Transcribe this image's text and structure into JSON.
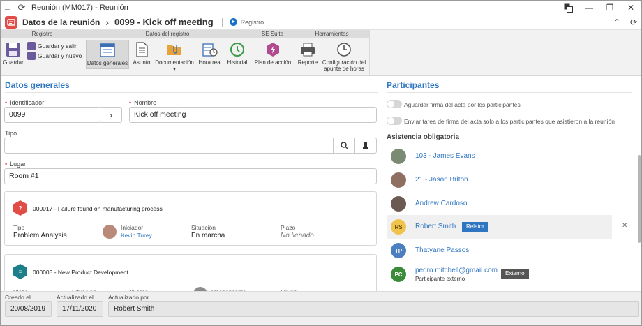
{
  "window": {
    "title": "Reunión (MM017) - Reunión"
  },
  "header": {
    "module": "Datos de la reunión",
    "record_title": "0099 - Kick off meeting",
    "record_link": "Registro"
  },
  "ribbon": {
    "groups": {
      "registro": "Registro",
      "datos": "Datos del registro",
      "suite": "SE Suite",
      "herramientas": "Herramientas"
    },
    "guardar": "Guardar",
    "guardar_salir": "Guardar y salir",
    "guardar_nuevo": "Guardar y nuevo",
    "datos_generales": "Datos generales",
    "asunto": "Asunto",
    "documentacion": "Documentación",
    "hora_real": "Hora real",
    "historial": "Historial",
    "plan_accion": "Plan de acción",
    "reporte": "Reporte",
    "config_1": "Configuración del",
    "config_2": "apunte de horas"
  },
  "general": {
    "title": "Datos generales",
    "identificador_label": "Identificador",
    "identificador": "0099",
    "nombre_label": "Nombre",
    "nombre": "Kick off meeting",
    "tipo_label": "Tipo",
    "tipo": "",
    "lugar_label": "Lugar",
    "lugar": "Room #1"
  },
  "cards": [
    {
      "code": "000017 - Failure found on manufacturing process",
      "tipo_label": "Tipo",
      "tipo": "Problem Analysis",
      "iniciador_label": "Iniciador",
      "iniciador": "Kevin Turey",
      "situacion_label": "Situación",
      "situacion": "En marcha",
      "plazo_label": "Plazo",
      "plazo": "No llenado"
    },
    {
      "code": "000003 - New Product Development",
      "labels": [
        "Plazo",
        "Situación",
        "% Real",
        "Responsable",
        "Grupo"
      ]
    }
  ],
  "participants": {
    "title": "Participantes",
    "toggle1": "Aguardar firma del acta por los participantes",
    "toggle2": "Enviar tarea de firma del acta solo a los participantes que asistieron a la reunión",
    "subtitle": "Asistencia obligatoria",
    "list": [
      {
        "name": "103 - James Evans"
      },
      {
        "name": "21 - Jason Briton"
      },
      {
        "name": "Andrew Cardoso"
      },
      {
        "initials": "RS",
        "name": "Robert Smith",
        "badge": "Relator"
      },
      {
        "initials": "TP",
        "name": "Thatyane Passos"
      },
      {
        "initials": "PC",
        "name": "pedro.mitchell@gmail.com",
        "sub": "Participante externo",
        "badge": "Externo"
      }
    ]
  },
  "footer": {
    "creado_label": "Creado el",
    "creado": "20/08/2019",
    "actualizado_label": "Actualizado el",
    "actualizado": "17/11/2020",
    "actualizado_por_label": "Actualizado por",
    "actualizado_por": "Robert Smith"
  },
  "colors": {
    "accent": "#2f76c2",
    "brand_red": "#e14c47",
    "relator_badge": "#2f76c2",
    "externo_badge": "#555555"
  }
}
